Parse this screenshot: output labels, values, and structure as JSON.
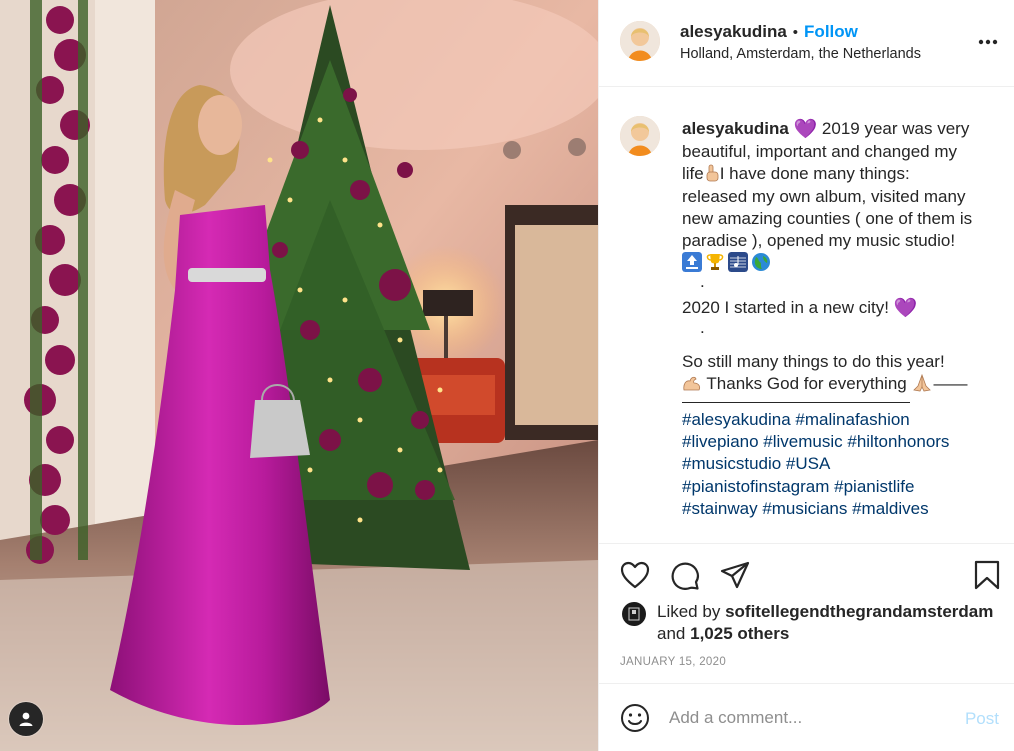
{
  "photo": {
    "alt_icon": "user-profile-icon"
  },
  "header": {
    "username": "alesyakudina",
    "dot": "•",
    "follow_label": "Follow",
    "location": "Holland, Amsterdam, the Netherlands",
    "more_icon": "more-options-icon"
  },
  "caption": {
    "username": "alesyakudina",
    "heart": "💜",
    "lines": [
      "2019 year was very",
      "beautiful, important and changed my",
      "life",
      "I have done many things:",
      "released my own album, visited many",
      "new amazing counties ( one of them is",
      "paradise ), opened my music studio!"
    ],
    "dot1": ".",
    "line_2020": "2020 I started in a new city!",
    "dot2": ".",
    "still": "So still many things to do this year!",
    "thanks": "Thanks God for everything",
    "dash": "——",
    "hashtags": [
      "#alesyakudina #malinafashion",
      "#livepiano #livemusic #hiltonhonors",
      "#musicstudio #USA",
      "#pianistofinstagram #pianistlife",
      "#stainway #musicians #maldives"
    ],
    "emoji_icons": [
      "top-icon",
      "trophy-icon",
      "musical-score-icon",
      "globe-icon"
    ]
  },
  "actions": {
    "like_icon": "heart-icon",
    "comment_icon": "comment-icon",
    "share_icon": "share-icon",
    "save_icon": "bookmark-icon"
  },
  "likes": {
    "prefix": "Liked by",
    "user": "sofitellegendthegrandamsterdam",
    "and": "and",
    "count": "1,025 others"
  },
  "date": "JANUARY 15, 2020",
  "comment": {
    "placeholder": "Add a comment...",
    "post_label": "Post"
  },
  "colors": {
    "accent": "#0095f6",
    "link": "#00376b",
    "post_disabled": "#b2dffc",
    "muted": "#8e8e8e"
  }
}
